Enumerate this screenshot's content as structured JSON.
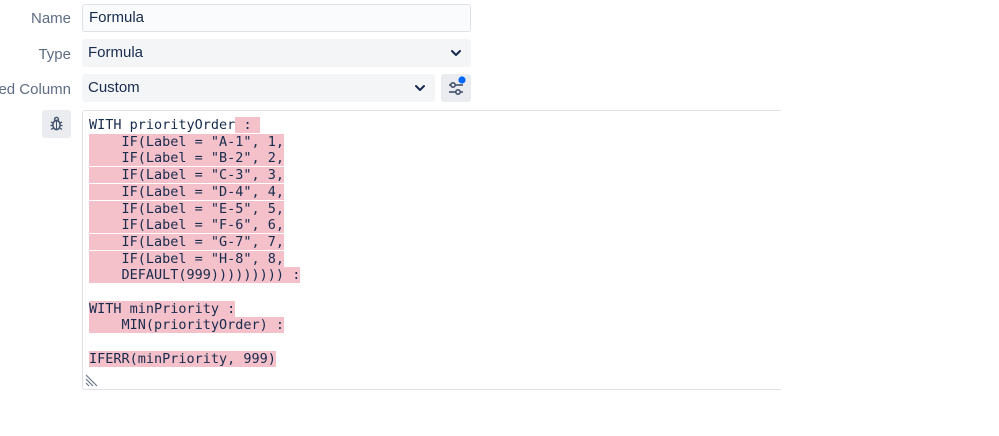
{
  "form": {
    "name_label": "Name",
    "name_value": "Formula",
    "type_label": "Type",
    "type_value": "Formula",
    "column_label": "ed Column",
    "column_value": "Custom"
  },
  "editor": {
    "lines": [
      {
        "plain": "WITH priorityOrder",
        "hl": " : "
      },
      {
        "plain": "",
        "hl": "    IF(Label = \"A-1\", 1,"
      },
      {
        "plain": "",
        "hl": "    IF(Label = \"B-2\", 2,"
      },
      {
        "plain": "",
        "hl": "    IF(Label = \"C-3\", 3,"
      },
      {
        "plain": "",
        "hl": "    IF(Label = \"D-4\", 4,"
      },
      {
        "plain": "",
        "hl": "    IF(Label = \"E-5\", 5,"
      },
      {
        "plain": "",
        "hl": "    IF(Label = \"F-6\", 6,"
      },
      {
        "plain": "",
        "hl": "    IF(Label = \"G-7\", 7,"
      },
      {
        "plain": "",
        "hl": "    IF(Label = \"H-8\", 8,"
      },
      {
        "plain": "",
        "hl": "    DEFAULT(999))))))))) :"
      },
      {
        "plain": "",
        "hl": ""
      },
      {
        "plain": "",
        "hl": "WITH minPriority :"
      },
      {
        "plain": "",
        "hl": "    MIN(priorityOrder) :"
      },
      {
        "plain": "",
        "hl": ""
      },
      {
        "plain": "",
        "hl": "IFERR(minPriority, 999)"
      }
    ]
  },
  "icons": {
    "type_chevron": "chevron-down-icon",
    "column_chevron": "chevron-down-icon",
    "settings": "sliders-icon",
    "debug": "bug-icon",
    "resize": "resize-handle-icon"
  },
  "colors": {
    "highlight": "#f4c0ca",
    "accent": "#0065ff"
  }
}
